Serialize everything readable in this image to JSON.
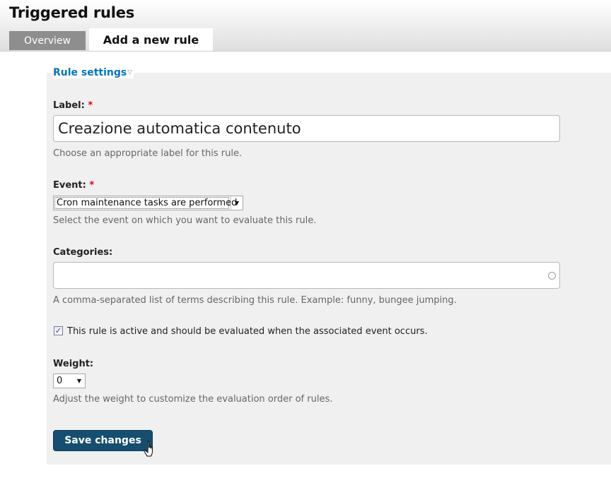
{
  "page": {
    "title": "Triggered rules"
  },
  "tabs": [
    {
      "label": "Overview",
      "active": false
    },
    {
      "label": "Add a new rule",
      "active": true
    }
  ],
  "fieldset": {
    "legend": "Rule settings",
    "toggle_glyph": "▽"
  },
  "form": {
    "label_field": {
      "label": "Label:",
      "required_marker": "*",
      "value": "Creazione automatica contenuto",
      "description": "Choose an appropriate label for this rule."
    },
    "event_field": {
      "label": "Event:",
      "required_marker": "*",
      "selected": "Cron maintenance tasks are performed",
      "arrow_glyph": "▼",
      "description": "Select the event on which you want to evaluate this rule."
    },
    "categories_field": {
      "label": "Categories:",
      "value": "",
      "description": "A comma-separated list of terms describing this rule. Example: funny, bungee jumping."
    },
    "active_checkbox": {
      "checked": true,
      "check_glyph": "✓",
      "label": "This rule is active and should be evaluated when the associated event occurs."
    },
    "weight_field": {
      "label": "Weight:",
      "selected": "0",
      "arrow_glyph": "▼",
      "description": "Adjust the weight to customize the evaluation order of rules."
    },
    "submit": {
      "label": "Save changes"
    }
  },
  "icons": {
    "cursor": "hand-pointer-icon",
    "autocomplete": "autocomplete-throbber-icon"
  },
  "colors": {
    "link_blue": "#0074bd",
    "button_bg": "#164e70",
    "required_red": "#e00000",
    "panel_bg": "#f0f0f0",
    "tab_inactive_bg": "#8e8e8e"
  }
}
